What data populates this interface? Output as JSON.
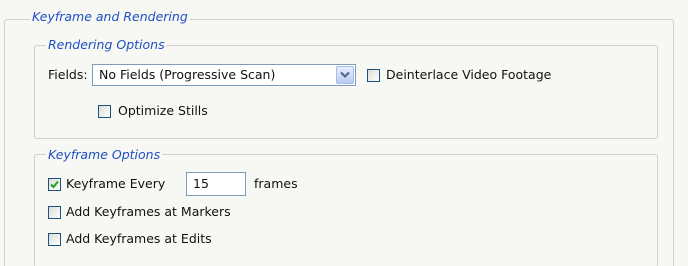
{
  "panel": {
    "title": "Keyframe and Rendering"
  },
  "rendering": {
    "legend": "Rendering Options",
    "fields_label": "Fields:",
    "fields_value": "No Fields (Progressive Scan)",
    "deinterlace_label": "Deinterlace Video Footage",
    "deinterlace_checked": false,
    "optimize_label": "Optimize Stills",
    "optimize_checked": false
  },
  "keyframe": {
    "legend": "Keyframe Options",
    "every_label": "Keyframe Every",
    "every_checked": true,
    "every_value": "15",
    "frames_label": "frames",
    "markers_label": "Add Keyframes at Markers",
    "markers_checked": false,
    "edits_label": "Add Keyframes at Edits",
    "edits_checked": false
  },
  "icons": {
    "dropdown": "chevron-down-icon",
    "check": "checkmark-icon"
  },
  "colors": {
    "legend_text": "#1f4fc4",
    "check_mark": "#21a121",
    "border": "#d3d1c4"
  }
}
